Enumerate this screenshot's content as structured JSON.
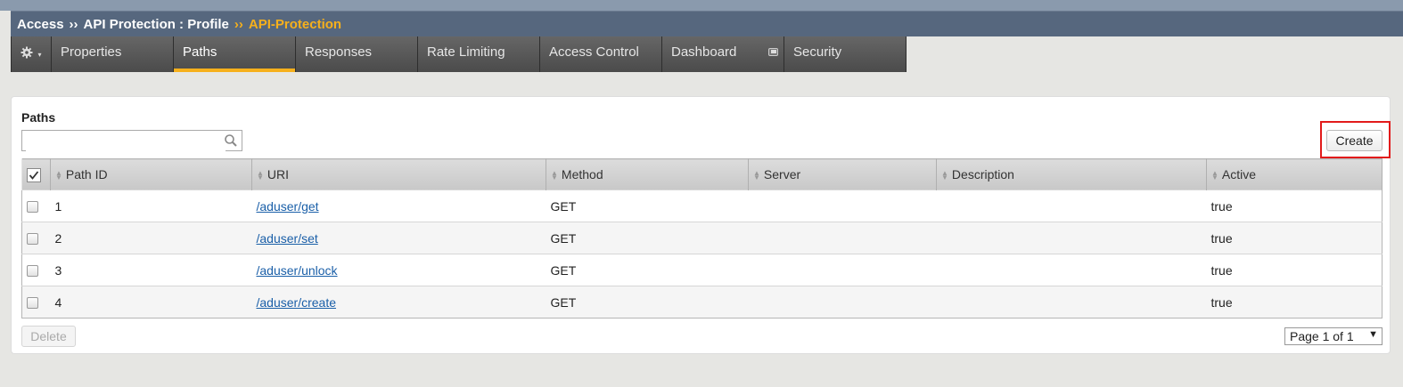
{
  "breadcrumb": {
    "items": [
      "Access",
      "API Protection : Profile"
    ],
    "separator": "››",
    "current": "API-Protection"
  },
  "tabs": [
    {
      "label": "Properties"
    },
    {
      "label": "Paths",
      "active": true
    },
    {
      "label": "Responses"
    },
    {
      "label": "Rate Limiting"
    },
    {
      "label": "Access Control"
    },
    {
      "label": "Dashboard",
      "icon": "popout-window-icon"
    },
    {
      "label": "Security"
    }
  ],
  "gear_menu": {
    "icon": "gear-icon",
    "caret": "▾"
  },
  "paths_panel": {
    "title": "Paths",
    "search": {
      "value": "",
      "placeholder": ""
    },
    "create_label": "Create",
    "columns": [
      "Path ID",
      "URI",
      "Method",
      "Server",
      "Description",
      "Active"
    ],
    "rows": [
      {
        "id": "1",
        "uri": "/aduser/get",
        "method": "GET",
        "server": "",
        "description": "",
        "active": "true"
      },
      {
        "id": "2",
        "uri": "/aduser/set",
        "method": "GET",
        "server": "",
        "description": "",
        "active": "true"
      },
      {
        "id": "3",
        "uri": "/aduser/unlock",
        "method": "GET",
        "server": "",
        "description": "",
        "active": "true"
      },
      {
        "id": "4",
        "uri": "/aduser/create",
        "method": "GET",
        "server": "",
        "description": "",
        "active": "true"
      }
    ],
    "delete_label": "Delete",
    "pager": {
      "label": "Page 1 of 1",
      "arrow": "▼"
    }
  },
  "colors": {
    "accent": "#f6b01c",
    "header_bg": "#56677e",
    "highlight_border": "#e21b1b",
    "link": "#1a5fa8"
  }
}
